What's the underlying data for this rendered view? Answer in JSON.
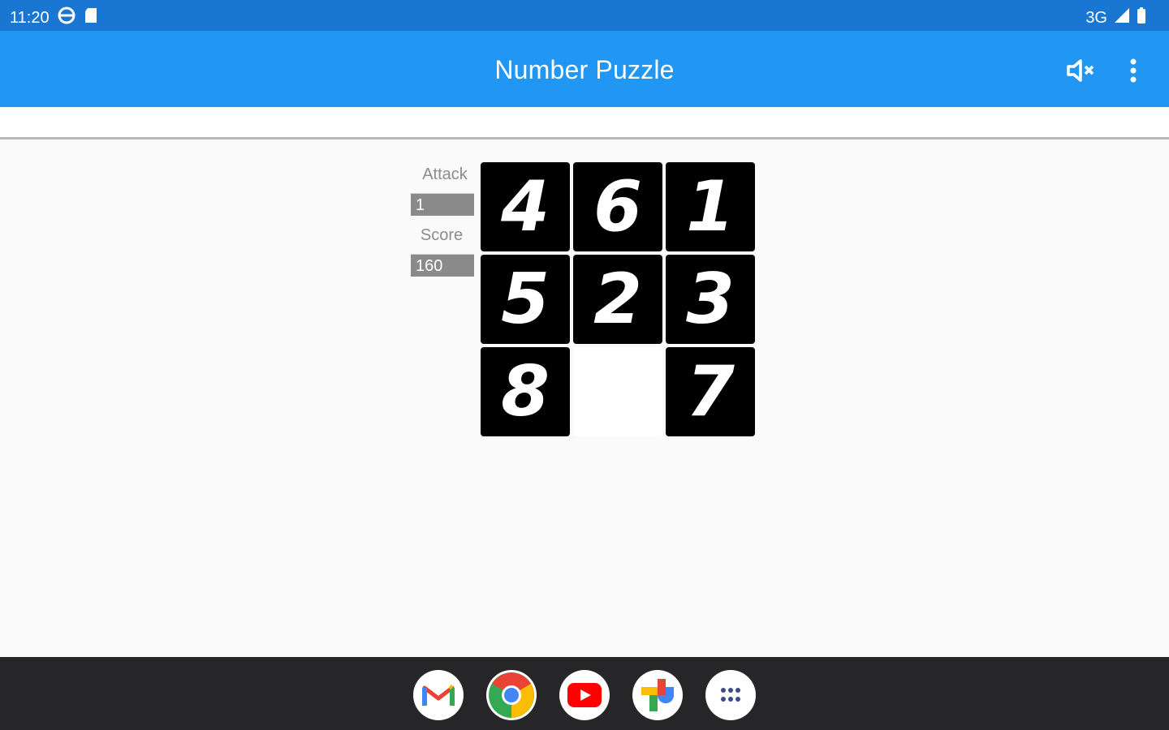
{
  "status": {
    "time": "11:20",
    "network": "3G"
  },
  "app_bar": {
    "title": "Number Puzzle",
    "mute_icon": "volume-off-icon",
    "more_icon": "more-vert-icon"
  },
  "stats": {
    "attack_label": "Attack",
    "attack_value": "1",
    "score_label": "Score",
    "score_value": "160"
  },
  "board": {
    "tiles": [
      "4",
      "6",
      "1",
      "5",
      "2",
      "3",
      "8",
      "",
      "7"
    ]
  },
  "dock": {
    "apps": [
      "gmail-icon",
      "chrome-icon",
      "youtube-icon",
      "photos-icon",
      "app-drawer-icon"
    ]
  },
  "colors": {
    "status_bar": "#1976d2",
    "app_bar": "#2196f3",
    "tile": "#000000",
    "dock": "#262628"
  }
}
